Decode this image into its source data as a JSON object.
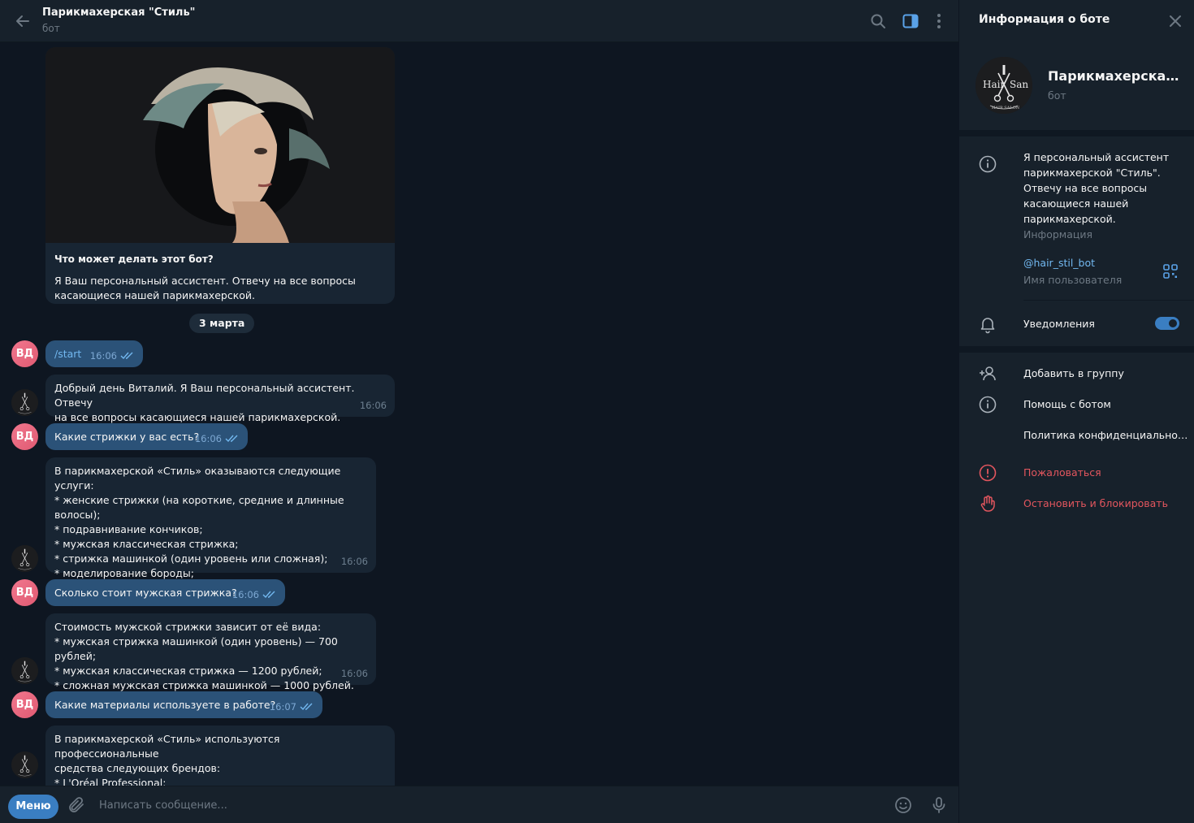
{
  "header": {
    "title": "Парикмахерская \"Стиль\"",
    "subtitle": "бот"
  },
  "intro": {
    "title": "Что может делать этот бот?",
    "text": "Я Ваш персональный ассистент. Отвечу на все вопросы касающиеся нашей парикмахерской."
  },
  "date_separator": "3 марта",
  "user_initials": "ВД",
  "messages": [
    {
      "text": "/start",
      "time": "16:06"
    },
    {
      "text": "Добрый день Виталий. Я Ваш персональный ассистент. Отвечу\nна все вопросы касающиеся нашей парикмахерской.",
      "time": "16:06"
    },
    {
      "text": "Какие стрижки у вас есть?",
      "time": "16:06"
    },
    {
      "text": "В парикмахерской «Стиль» оказываются следующие услуги:\n* женские стрижки (на короткие, средние и длинные волосы);\n* подравнивание кончиков;\n* мужская классическая стрижка;\n* стрижка машинкой (один уровень или сложная);\n* моделирование бороды;\n* королевское бритьё.",
      "time": "16:06"
    },
    {
      "text": "Сколько стоит мужская стрижка?",
      "time": "16:06"
    },
    {
      "text": "Стоимость мужской стрижки зависит от её вида:\n* мужская стрижка машинкой (один уровень) — 700 рублей;\n* мужская классическая стрижка — 1200 рублей;\n* сложная мужская стрижка машинкой — 1000 рублей.",
      "time": "16:06"
    },
    {
      "text": "Какие материалы используете в работе?",
      "time": "16:07"
    },
    {
      "text": "В парикмахерской «Стиль» используются профессиональные\nсредства следующих брендов:\n* L'Oréal Professional;\n* Wella Professionals;",
      "time": ""
    }
  ],
  "composer": {
    "menu_label": "Меню",
    "placeholder": "Написать сообщение..."
  },
  "panel": {
    "title": "Информация о боте",
    "bot_name": "Парикмахерская \"Стиль\"",
    "bot_sub": "бот",
    "info_text": "Я персональный ассистент парикмахерской \"Стиль\". Отвечу на все вопросы касающиеся нашей парикмахерской.",
    "info_label": "Информация",
    "username": "@hair_stil_bot",
    "username_label": "Имя пользователя",
    "notifications": "Уведомления",
    "notifications_on": true,
    "add_to_group": "Добавить в группу",
    "help": "Помощь с ботом",
    "privacy": "Политика конфиденциальности",
    "report": "Пожаловаться",
    "block": "Остановить и блокировать"
  },
  "logo": {
    "left": "Hair",
    "right": "San",
    "ring": "HAIR SALON"
  },
  "colors": {
    "accent": "#3a7ec2",
    "outgoing_bubble": "#2b5278",
    "incoming_bubble": "#182533",
    "danger": "#e3565e",
    "link": "#72b8f0"
  }
}
